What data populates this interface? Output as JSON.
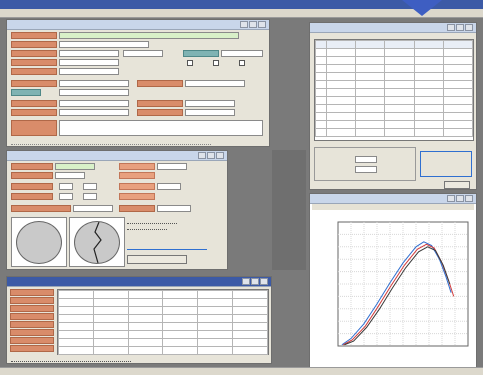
{
  "app": {
    "title_bar": "",
    "menu": "",
    "accent_color": "#3c5aa6",
    "label_color": "#d98c6a",
    "teal_label_color": "#7fb3b3"
  },
  "panels": {
    "main_form": {
      "title": ""
    },
    "specimen": {
      "title": ""
    },
    "results": {
      "title": "",
      "footer_text": ""
    },
    "data_table": {
      "title": "",
      "columns": [
        "",
        "",
        "",
        "",
        "",
        ""
      ]
    },
    "graph": {
      "title": ""
    }
  },
  "chart_data": {
    "type": "line",
    "title": "",
    "xlabel": "",
    "ylabel": "",
    "xlim": [
      0,
      10
    ],
    "ylim": [
      0,
      10
    ],
    "grid": true,
    "series": [
      {
        "color": "#2f6fd0",
        "x": [
          0.3,
          1.0,
          2.0,
          3.0,
          4.0,
          5.0,
          6.0,
          6.6,
          7.2,
          7.8,
          8.3,
          8.7
        ],
        "y": [
          0.1,
          0.6,
          1.8,
          3.4,
          5.1,
          6.7,
          8.0,
          8.4,
          8.1,
          7.0,
          5.6,
          4.3
        ]
      },
      {
        "color": "#d23a3a",
        "x": [
          0.4,
          1.1,
          2.1,
          3.1,
          4.1,
          5.1,
          6.1,
          6.8,
          7.4,
          8.0,
          8.5,
          8.9
        ],
        "y": [
          0.1,
          0.5,
          1.6,
          3.2,
          4.9,
          6.5,
          7.8,
          8.2,
          7.9,
          6.7,
          5.3,
          4.0
        ]
      },
      {
        "color": "#3a3a3a",
        "x": [
          0.5,
          1.2,
          2.2,
          3.2,
          4.2,
          5.2,
          6.2,
          6.9,
          7.5,
          8.1,
          8.6
        ],
        "y": [
          0.1,
          0.4,
          1.5,
          3.0,
          4.7,
          6.3,
          7.6,
          8.0,
          7.7,
          6.5,
          5.0
        ]
      }
    ]
  }
}
